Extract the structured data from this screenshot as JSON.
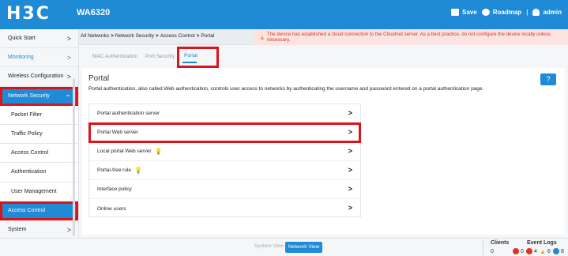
{
  "header": {
    "logo": "H3C",
    "model": "WA6320",
    "save_label": "Save",
    "roadmap_label": "Roadmap",
    "separator": "|",
    "user_label": "admin"
  },
  "sidebar": {
    "items": [
      {
        "label": "Quick Start",
        "chevron": ">"
      },
      {
        "label": "Monitoring",
        "chevron": ">"
      },
      {
        "label": "Wireless Configuration",
        "chevron": ">"
      },
      {
        "label": "Network Security",
        "chevron": "⌄"
      },
      {
        "label": "Packet Filter"
      },
      {
        "label": "Traffic Policy"
      },
      {
        "label": "Access Control"
      },
      {
        "label": "Authentication"
      },
      {
        "label": "User Management"
      },
      {
        "label": "Access Control"
      },
      {
        "label": "System",
        "chevron": ">"
      }
    ]
  },
  "breadcrumb": {
    "items": [
      "All Networks",
      "Network Security",
      "Access Control",
      "Portal"
    ],
    "separator": ">"
  },
  "warning": {
    "text": "The device has established a cloud connection to the Cloudnet server. As a best practice, do not configure the device locally unless necessary."
  },
  "tabs": [
    {
      "label": "MAC Authentication"
    },
    {
      "label": "Port Security"
    },
    {
      "label": "Portal"
    }
  ],
  "page": {
    "title": "Portal",
    "description": "Portal authentication, also called Web authentication, controls user access to networks by authenticating the username and password entered on a portal authentication page.",
    "help": "?"
  },
  "list": {
    "arrow": ">",
    "items": [
      {
        "label": "Portal authentication server",
        "bulb": false
      },
      {
        "label": "Portal Web server",
        "bulb": false
      },
      {
        "label": "Local portal Web server",
        "bulb": true
      },
      {
        "label": "Portal-free rule",
        "bulb": true
      },
      {
        "label": "Interface policy",
        "bulb": false
      },
      {
        "label": "Online users",
        "bulb": false
      }
    ]
  },
  "statusbar": {
    "system_view": "System View",
    "network_view": "Network View",
    "clients_label": "Clients",
    "clients_value": "0",
    "event_logs_label": "Event Logs",
    "events": [
      {
        "icon": "error-icon",
        "count": "0",
        "color": "#e0302a"
      },
      {
        "icon": "minus-icon",
        "count": "4",
        "color": "#e0302a"
      },
      {
        "icon": "warning-icon",
        "count": "6",
        "color": "#f0a020"
      },
      {
        "icon": "info-icon",
        "count": "8",
        "color": "#1f8ad6"
      }
    ]
  },
  "colors": {
    "brand": "#1f8ad6",
    "highlight": "#d9141b",
    "warning_text": "#d0382e"
  }
}
